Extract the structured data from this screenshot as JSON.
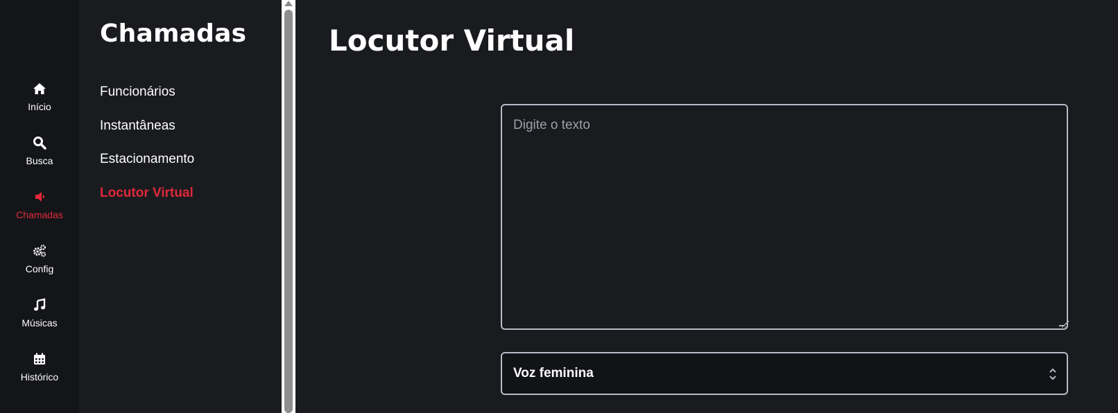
{
  "rail": {
    "items": [
      {
        "label": "Início",
        "icon": "home-icon",
        "active": false
      },
      {
        "label": "Busca",
        "icon": "search-icon",
        "active": false
      },
      {
        "label": "Chamadas",
        "icon": "megaphone-icon",
        "active": true
      },
      {
        "label": "Config",
        "icon": "gears-icon",
        "active": false
      },
      {
        "label": "Músicas",
        "icon": "music-note-icon",
        "active": false
      },
      {
        "label": "Histórico",
        "icon": "calendar-icon",
        "active": false
      }
    ]
  },
  "subnav": {
    "title": "Chamadas",
    "links": [
      {
        "label": "Funcionários",
        "active": false
      },
      {
        "label": "Instantâneas",
        "active": false
      },
      {
        "label": "Estacionamento",
        "active": false
      },
      {
        "label": "Locutor Virtual",
        "active": true
      }
    ]
  },
  "main": {
    "title": "Locutor Virtual",
    "text_input": {
      "value": "",
      "placeholder": "Digite o texto"
    },
    "voice_select": {
      "selected": "Voz feminina"
    }
  },
  "colors": {
    "accent": "#e0283a",
    "background": "#1a1b1f",
    "rail_background": "#141518",
    "border": "#b7bcc6"
  }
}
